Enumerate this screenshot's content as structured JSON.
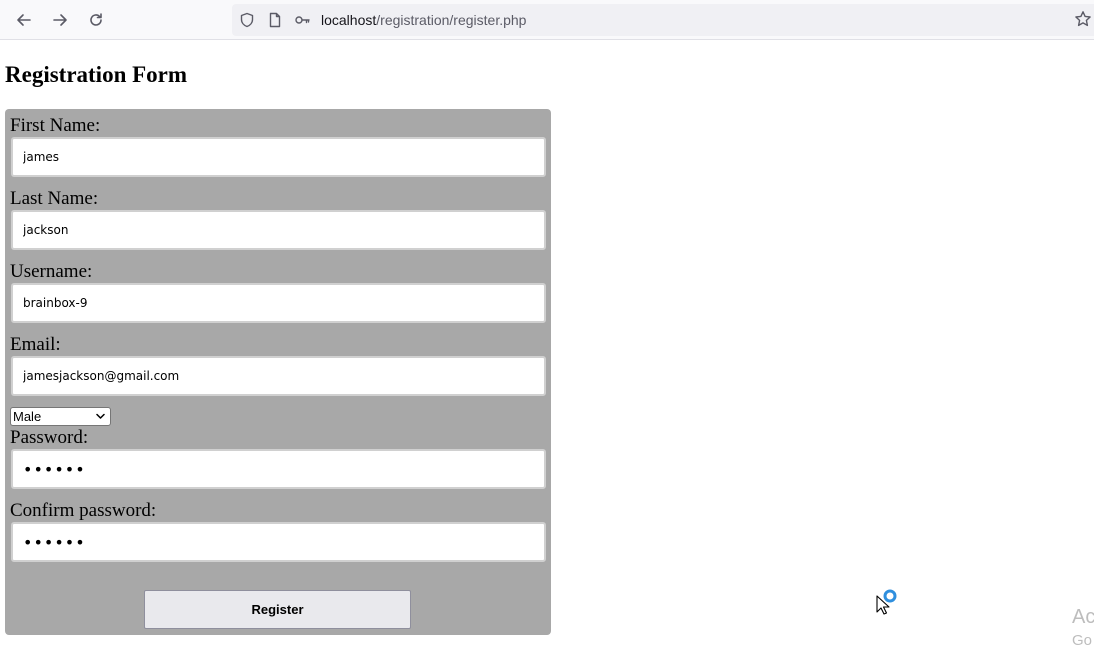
{
  "browser": {
    "url_host": "localhost",
    "url_path": "/registration/register.php"
  },
  "page": {
    "title": "Registration Form"
  },
  "form": {
    "first_name": {
      "label": "First Name:",
      "value": "james"
    },
    "last_name": {
      "label": "Last Name:",
      "value": "jackson"
    },
    "username": {
      "label": "Username:",
      "value": "brainbox-9"
    },
    "email": {
      "label": "Email:",
      "value": "jamesjackson@gmail.com"
    },
    "gender": {
      "selected": "Male"
    },
    "password": {
      "label": "Password:",
      "value": "123456"
    },
    "confirm_password": {
      "label": "Confirm password:",
      "value": "123456"
    },
    "submit_label": "Register"
  },
  "watermark": {
    "line1": "Ac",
    "line2": "Go"
  },
  "icons": {
    "back": "arrow-left-icon",
    "forward": "arrow-right-icon",
    "reload": "reload-icon",
    "shield": "shield-icon",
    "page": "page-icon",
    "permissions": "key-icon",
    "bookmark": "star-icon"
  }
}
